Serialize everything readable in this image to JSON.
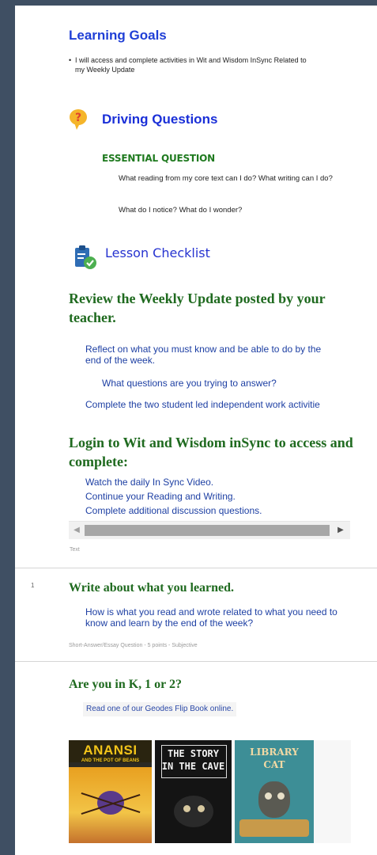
{
  "learning_goals": {
    "heading": "Learning Goals",
    "items": [
      "I will access and complete activities in Wit and Wisdom InSync Related to my Weekly Update"
    ]
  },
  "driving_questions": {
    "heading": "Driving Questions",
    "essential_label": "ESSENTIAL QUESTION",
    "questions": [
      "What reading from my core text can I do? What writing can I do?",
      "What do I notice? What do I wonder?"
    ]
  },
  "lesson_checklist": {
    "heading": "Lesson Checklist",
    "review_heading": "Review the Weekly Update posted by your teacher.",
    "review_items": [
      "Reflect on what you must know and be able to do by the end of the week.",
      "What questions are you trying to answer?",
      "Complete the two student led independent work activitie"
    ],
    "login_heading": "Login to Wit and Wisdom inSync to access and complete:",
    "login_items": [
      "Watch the daily In Sync Video.",
      "Continue your Reading and Writing.",
      "Complete additional discussion questions."
    ],
    "type_label": "Text"
  },
  "question1": {
    "number": "1",
    "heading": "Write about what you learned.",
    "prompt": "How is what you read and wrote related to what you need to know and learn by the end of the week?",
    "meta": "Short-Answer/Essay Question - 5 points - Subjective"
  },
  "flipbooks": {
    "heading": "Are you in K, 1 or 2?",
    "prompt": "Read one of our Geodes Flip Book online.",
    "books": [
      {
        "title_line1": "ANANSI",
        "title_line2": "AND THE POT OF BEANS"
      },
      {
        "title_line1": "THE STORY",
        "title_line2": "IN THE CAVE"
      },
      {
        "title_line1": "LIBRARY",
        "title_line2": "CAT"
      }
    ]
  },
  "colors": {
    "heading_blue": "#1f3fd6",
    "heading_green": "#1f6a1f",
    "body_blue": "#1d3fa3",
    "frame": "#3f4f63"
  },
  "icons": {
    "driving": "question-bubble-icon",
    "checklist": "clipboard-check-icon",
    "scroll_left": "scroll-left-arrow-icon",
    "scroll_right": "scroll-right-arrow-icon"
  }
}
